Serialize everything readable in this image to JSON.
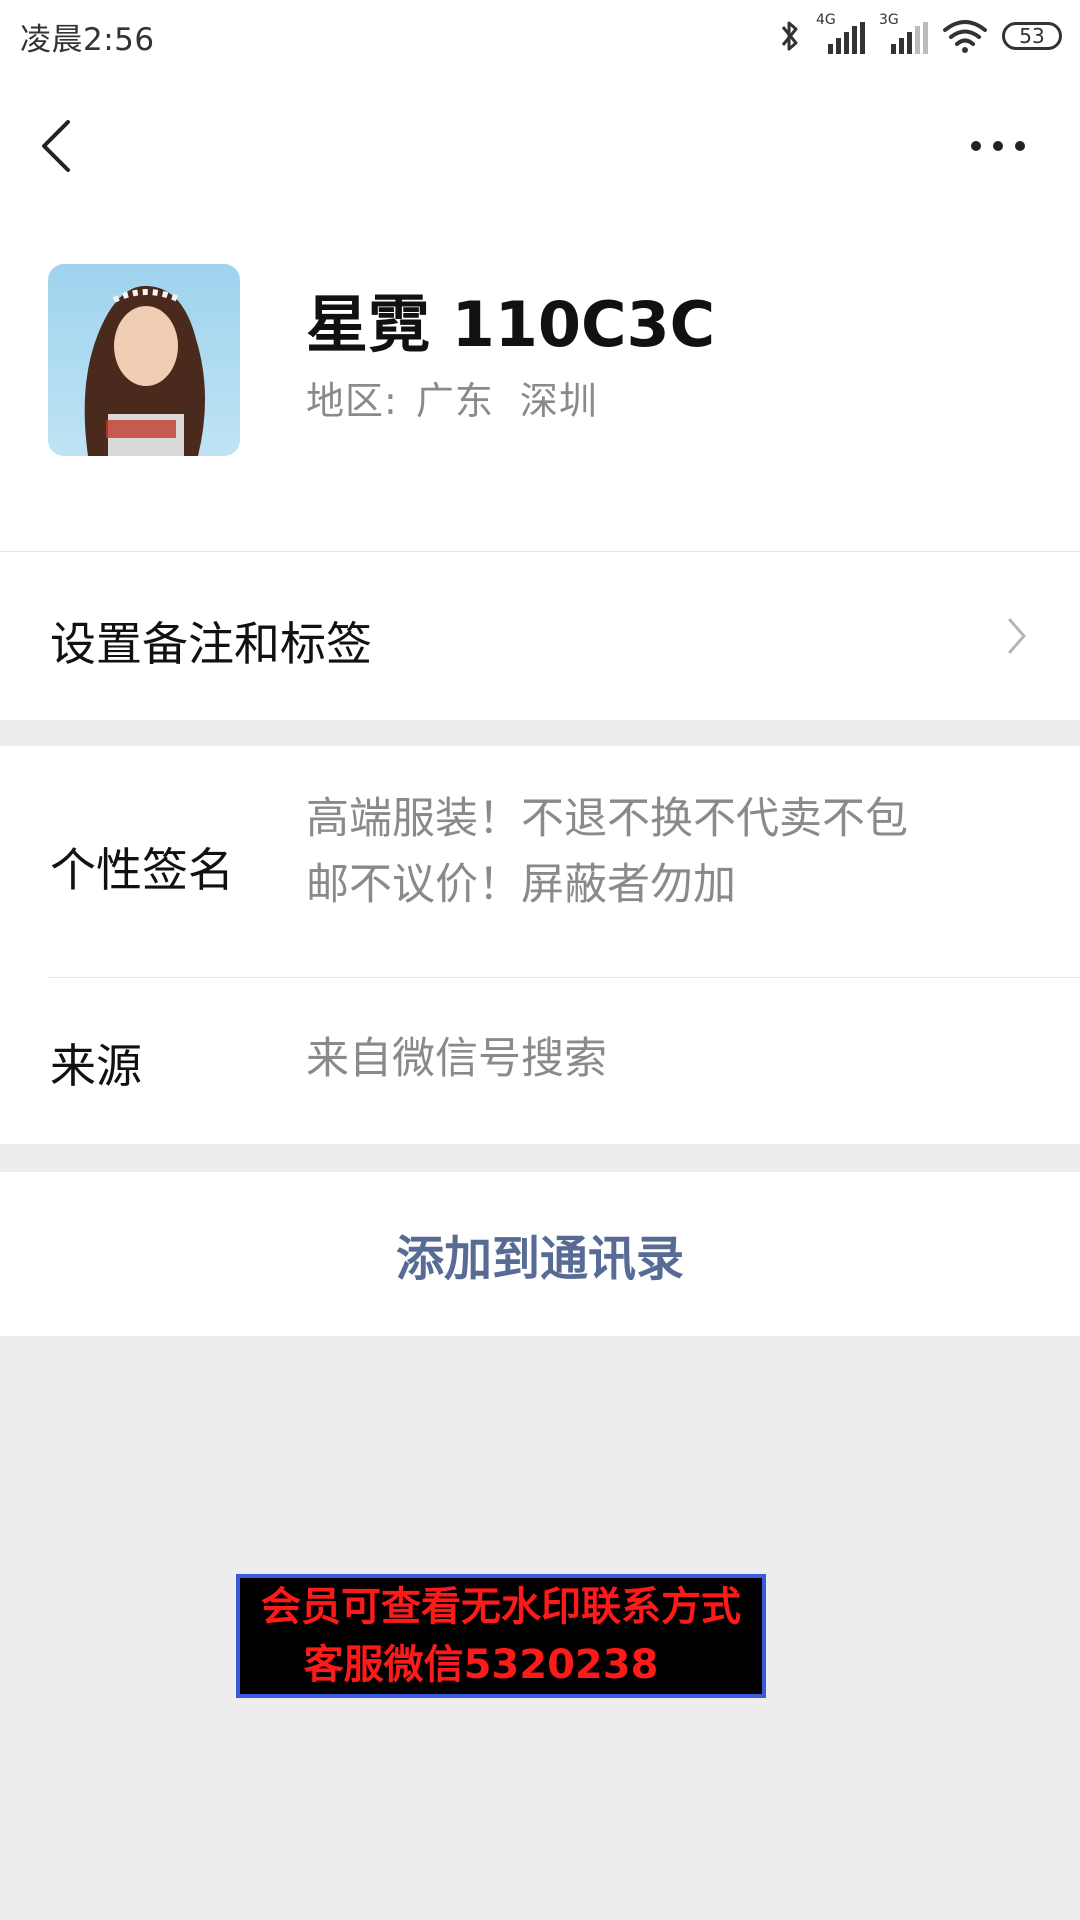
{
  "status_bar": {
    "time": "凌晨2:56",
    "signal1_tag": "4G",
    "signal2_tag": "3G",
    "battery": "53"
  },
  "nav": {
    "back_icon": "chevron-left-icon",
    "more_icon": "ellipsis-icon"
  },
  "profile": {
    "name": "星霓 110C3C",
    "region_label": "地区:",
    "region_province": "广东",
    "region_city": "深圳"
  },
  "rows": {
    "remark": {
      "label": "设置备注和标签"
    },
    "signature": {
      "label": "个性签名",
      "value_line1": "高端服装！不退不换不代卖不包",
      "value_line2": "邮不议价！屏蔽者勿加"
    },
    "source": {
      "label": "来源",
      "value": "来自微信号搜索"
    }
  },
  "add_button": {
    "label": "添加到通讯录"
  },
  "watermark": {
    "line1": "会员可查看无水印联系方式",
    "line2": "客服微信5320238"
  },
  "colors": {
    "link_blue": "#576b95",
    "secondary_text": "#8a8a8a",
    "page_bg": "#ededed"
  }
}
